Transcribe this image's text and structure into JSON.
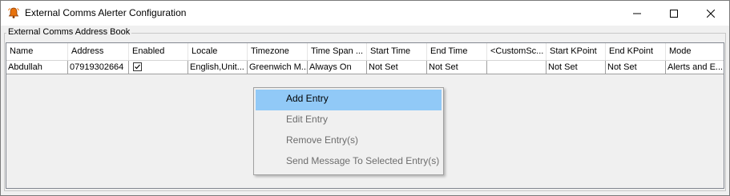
{
  "window": {
    "title": "External Comms Alerter Configuration",
    "icon": "app-alert-icon",
    "controls": [
      "minimize-icon",
      "maximize-icon",
      "close-icon"
    ]
  },
  "groupbox": {
    "label": "External Comms Address Book"
  },
  "grid": {
    "columns": [
      "Name",
      "Address",
      "Enabled",
      "Locale",
      "Timezone",
      "Time Span ...",
      "Start Time",
      "End Time",
      "<CustomSc...",
      "Start KPoint",
      "End KPoint",
      "Mode"
    ],
    "rows": [
      {
        "name": "Abdullah",
        "address": "07919302664",
        "enabled": true,
        "locale": "English,Unit...",
        "timezone": "Greenwich M...",
        "time_span": "Always On",
        "start_time": "Not Set",
        "end_time": "Not Set",
        "custom": "",
        "start_kpoint": "Not Set",
        "end_kpoint": "Not Set",
        "mode": "Alerts and E..."
      }
    ]
  },
  "context_menu": {
    "items": [
      {
        "label": "Add Entry",
        "state": "highlighted"
      },
      {
        "label": "Edit Entry",
        "state": "disabled"
      },
      {
        "label": "Remove Entry(s)",
        "state": "disabled"
      },
      {
        "label": "Send Message To Selected Entry(s)",
        "state": "disabled"
      }
    ]
  },
  "colors": {
    "menu_highlight": "#91c9f7",
    "disabled_text": "#6d6d6d",
    "app_icon": "#e8720c"
  }
}
